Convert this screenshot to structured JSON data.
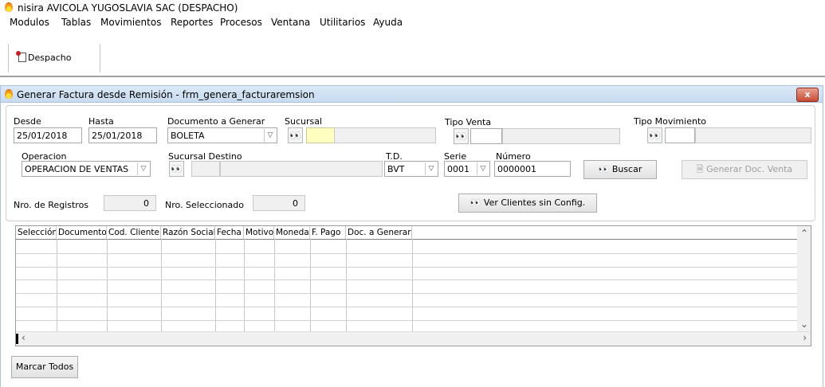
{
  "app": {
    "title": "nisira AVICOLA YUGOSLAVIA SAC (DESPACHO)"
  },
  "menu": [
    {
      "label": "Modulos"
    },
    {
      "label": "Tablas"
    },
    {
      "label": "Movimientos"
    },
    {
      "label": "Reportes"
    },
    {
      "label": "Procesos"
    },
    {
      "label": "Ventana"
    },
    {
      "label": "Utilitarios"
    },
    {
      "label": "Ayuda"
    }
  ],
  "toolbar": {
    "despacho_label": "Despacho"
  },
  "window": {
    "title": "Generar Factura desde Remisión - frm_genera_facturaremsion",
    "close_label": "x"
  },
  "form": {
    "desde": {
      "label": "Desde",
      "value": "25/01/2018"
    },
    "hasta": {
      "label": "Hasta",
      "value": "25/01/2018"
    },
    "documento": {
      "label": "Documento a Generar",
      "value": "BOLETA"
    },
    "sucursal": {
      "label": "Sucursal",
      "code": "",
      "name": ""
    },
    "tipo_venta": {
      "label": "Tipo Venta",
      "code": "",
      "name": ""
    },
    "tipo_movimiento": {
      "label": "Tipo Movimiento",
      "code": "",
      "name": ""
    },
    "operacion": {
      "label": "Operacion",
      "value": "OPERACION DE VENTAS"
    },
    "sucursal_destino": {
      "label": "Sucursal Destino",
      "code": "",
      "name": ""
    },
    "td": {
      "label": "T.D.",
      "value": "BVT"
    },
    "serie": {
      "label": "Serie",
      "value": "0001"
    },
    "numero": {
      "label": "Número",
      "value": "0000001"
    },
    "buscar_label": "Buscar",
    "generar_label": "Generar Doc. Venta",
    "nro_registros": {
      "label": "Nro. de Registros",
      "value": "0"
    },
    "nro_seleccionado": {
      "label": "Nro. Seleccionado",
      "value": "0"
    },
    "ver_clientes_label": "Ver Clientes sin Config."
  },
  "grid": {
    "columns": [
      "Selección",
      "Documento",
      "Cod. Cliente",
      "Razón Social",
      "Fecha",
      "Motivo",
      "Moneda",
      "F. Pago",
      "Doc. a Generar"
    ]
  },
  "footer": {
    "marcar_todos_label": "Marcar Todos"
  },
  "icons": {
    "app": "flame-icon",
    "binoculars": "binoculars-icon",
    "document": "document-icon"
  }
}
